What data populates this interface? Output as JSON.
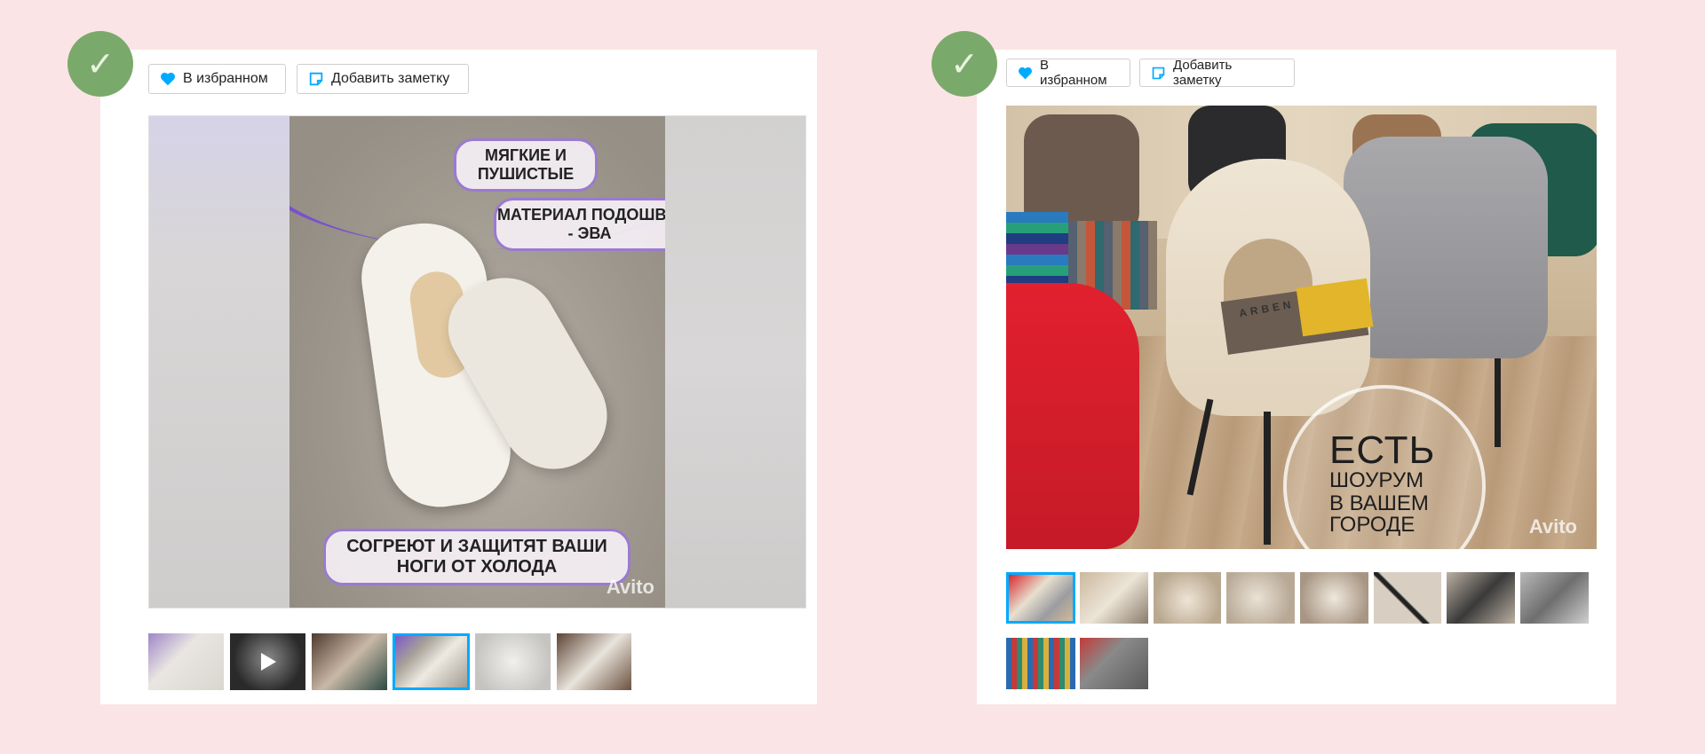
{
  "listings": [
    {
      "favorite_label": "В избранном",
      "note_label": "Добавить заметку",
      "photo_texts": [
        "МЯГКИЕ И ПУШИСТЫЕ",
        "МАТЕРИАЛ ПОДОШВЫ - ЭВА",
        "СОГРЕЮТ И ЗАЩИТЯТ ВАШИ НОГИ ОТ ХОЛОДА"
      ],
      "watermark": "Avito",
      "thumbnail_count": 6,
      "active_thumbnail": 4
    },
    {
      "favorite_label": "В избранном",
      "note_label": "Добавить заметку",
      "photo_texts": [
        "ЕСТЬ",
        "ШОУРУМ",
        "В ВАШЕМ",
        "ГОРОДЕ"
      ],
      "fabric_tag": "ARBEN",
      "watermark": "Avito",
      "thumbnail_count": 10,
      "active_thumbnail": 1
    }
  ],
  "colors": {
    "page_bg": "#fbe4e5",
    "check_badge": "#7aaa6b",
    "heart": "#00aaff",
    "active_border": "#00aaff",
    "pill_border": "#9b7ad0"
  },
  "icons": [
    "check-icon",
    "heart-icon",
    "note-icon",
    "play-icon"
  ]
}
